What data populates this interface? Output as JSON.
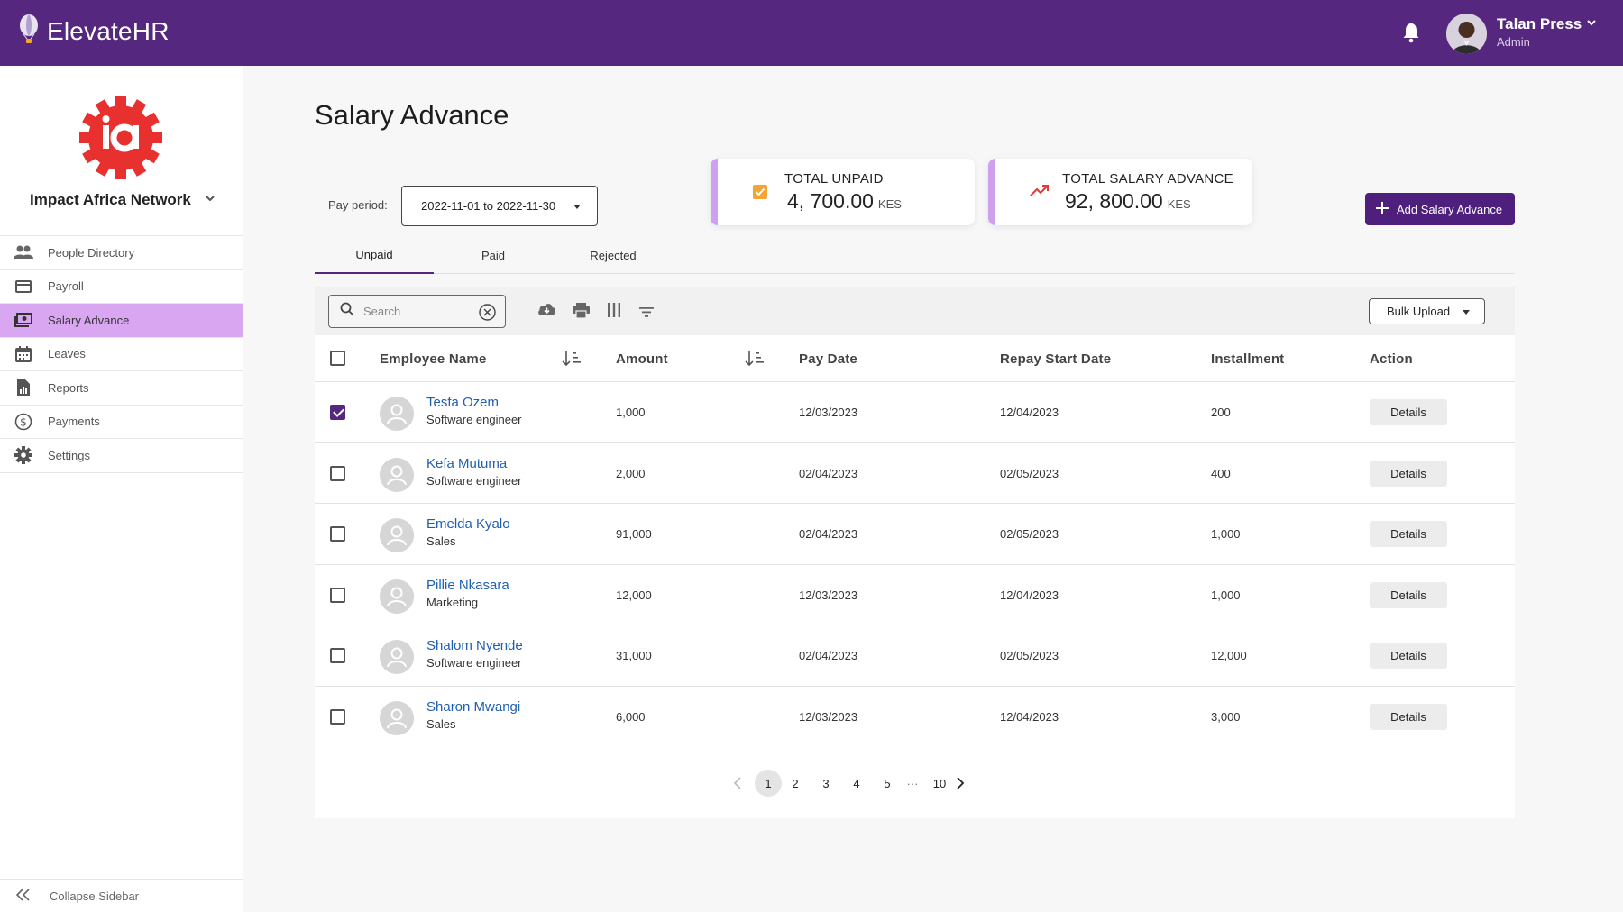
{
  "app": {
    "brand": "ElevateHR"
  },
  "user": {
    "name": "Talan Press",
    "role": "Admin"
  },
  "org": {
    "name": "Impact Africa Network"
  },
  "sidebar": {
    "items": [
      {
        "label": "People Directory",
        "icon": "people-icon"
      },
      {
        "label": "Payroll",
        "icon": "card-icon"
      },
      {
        "label": "Salary Advance",
        "icon": "cash-icon",
        "active": true
      },
      {
        "label": "Leaves",
        "icon": "calendar-icon"
      },
      {
        "label": "Reports",
        "icon": "report-icon"
      },
      {
        "label": "Payments",
        "icon": "dollar-icon"
      },
      {
        "label": "Settings",
        "icon": "gear-icon"
      }
    ],
    "collapse_label": "Collapse Sidebar"
  },
  "page": {
    "title": "Salary Advance",
    "pay_period_label": "Pay period:",
    "pay_period_value": "2022-11-01 to 2022-11-30"
  },
  "cards": {
    "unpaid": {
      "label": "TOTAL UNPAID",
      "value": "4, 700.00",
      "unit": "KES"
    },
    "total": {
      "label": "TOTAL SALARY ADVANCE",
      "value": "92, 800.00",
      "unit": "KES"
    }
  },
  "actions": {
    "add_label": "Add Salary Advance",
    "bulk_label": "Bulk Upload"
  },
  "tabs": [
    "Unpaid",
    "Paid",
    "Rejected"
  ],
  "search": {
    "placeholder": "Search"
  },
  "table": {
    "headers": {
      "name": "Employee Name",
      "amount": "Amount",
      "pay_date": "Pay Date",
      "repay_start": "Repay Start Date",
      "installment": "Installment",
      "action": "Action"
    },
    "details_label": "Details",
    "rows": [
      {
        "name": "Tesfa Ozem",
        "role": "Software engineer",
        "amount": "1,000",
        "pay_date": "12/03/2023",
        "repay_start": "12/04/2023",
        "installment": "200",
        "checked": true
      },
      {
        "name": "Kefa Mutuma",
        "role": "Software engineer",
        "amount": "2,000",
        "pay_date": "02/04/2023",
        "repay_start": "02/05/2023",
        "installment": "400",
        "checked": false
      },
      {
        "name": "Emelda Kyalo",
        "role": "Sales",
        "amount": "91,000",
        "pay_date": "02/04/2023",
        "repay_start": "02/05/2023",
        "installment": "1,000",
        "checked": false
      },
      {
        "name": "Pillie Nkasara",
        "role": "Marketing",
        "amount": "12,000",
        "pay_date": "12/03/2023",
        "repay_start": "12/04/2023",
        "installment": "1,000",
        "checked": false
      },
      {
        "name": "Shalom Nyende",
        "role": "Software engineer",
        "amount": "31,000",
        "pay_date": "02/04/2023",
        "repay_start": "02/05/2023",
        "installment": "12,000",
        "checked": false
      },
      {
        "name": "Sharon Mwangi",
        "role": "Sales",
        "amount": "6,000",
        "pay_date": "12/03/2023",
        "repay_start": "12/04/2023",
        "installment": "3,000",
        "checked": false
      }
    ]
  },
  "pagination": {
    "pages": [
      "1",
      "2",
      "3",
      "4",
      "5"
    ],
    "ellipsis": "···",
    "last": "10",
    "current": "1"
  },
  "colors": {
    "topbar": "#55277f",
    "accent": "#4e1f7c",
    "sidebar_active": "#d9a6f2",
    "card_border": "#cf9ff0",
    "link": "#1f5fb0",
    "logo_red": "#e8312f"
  }
}
